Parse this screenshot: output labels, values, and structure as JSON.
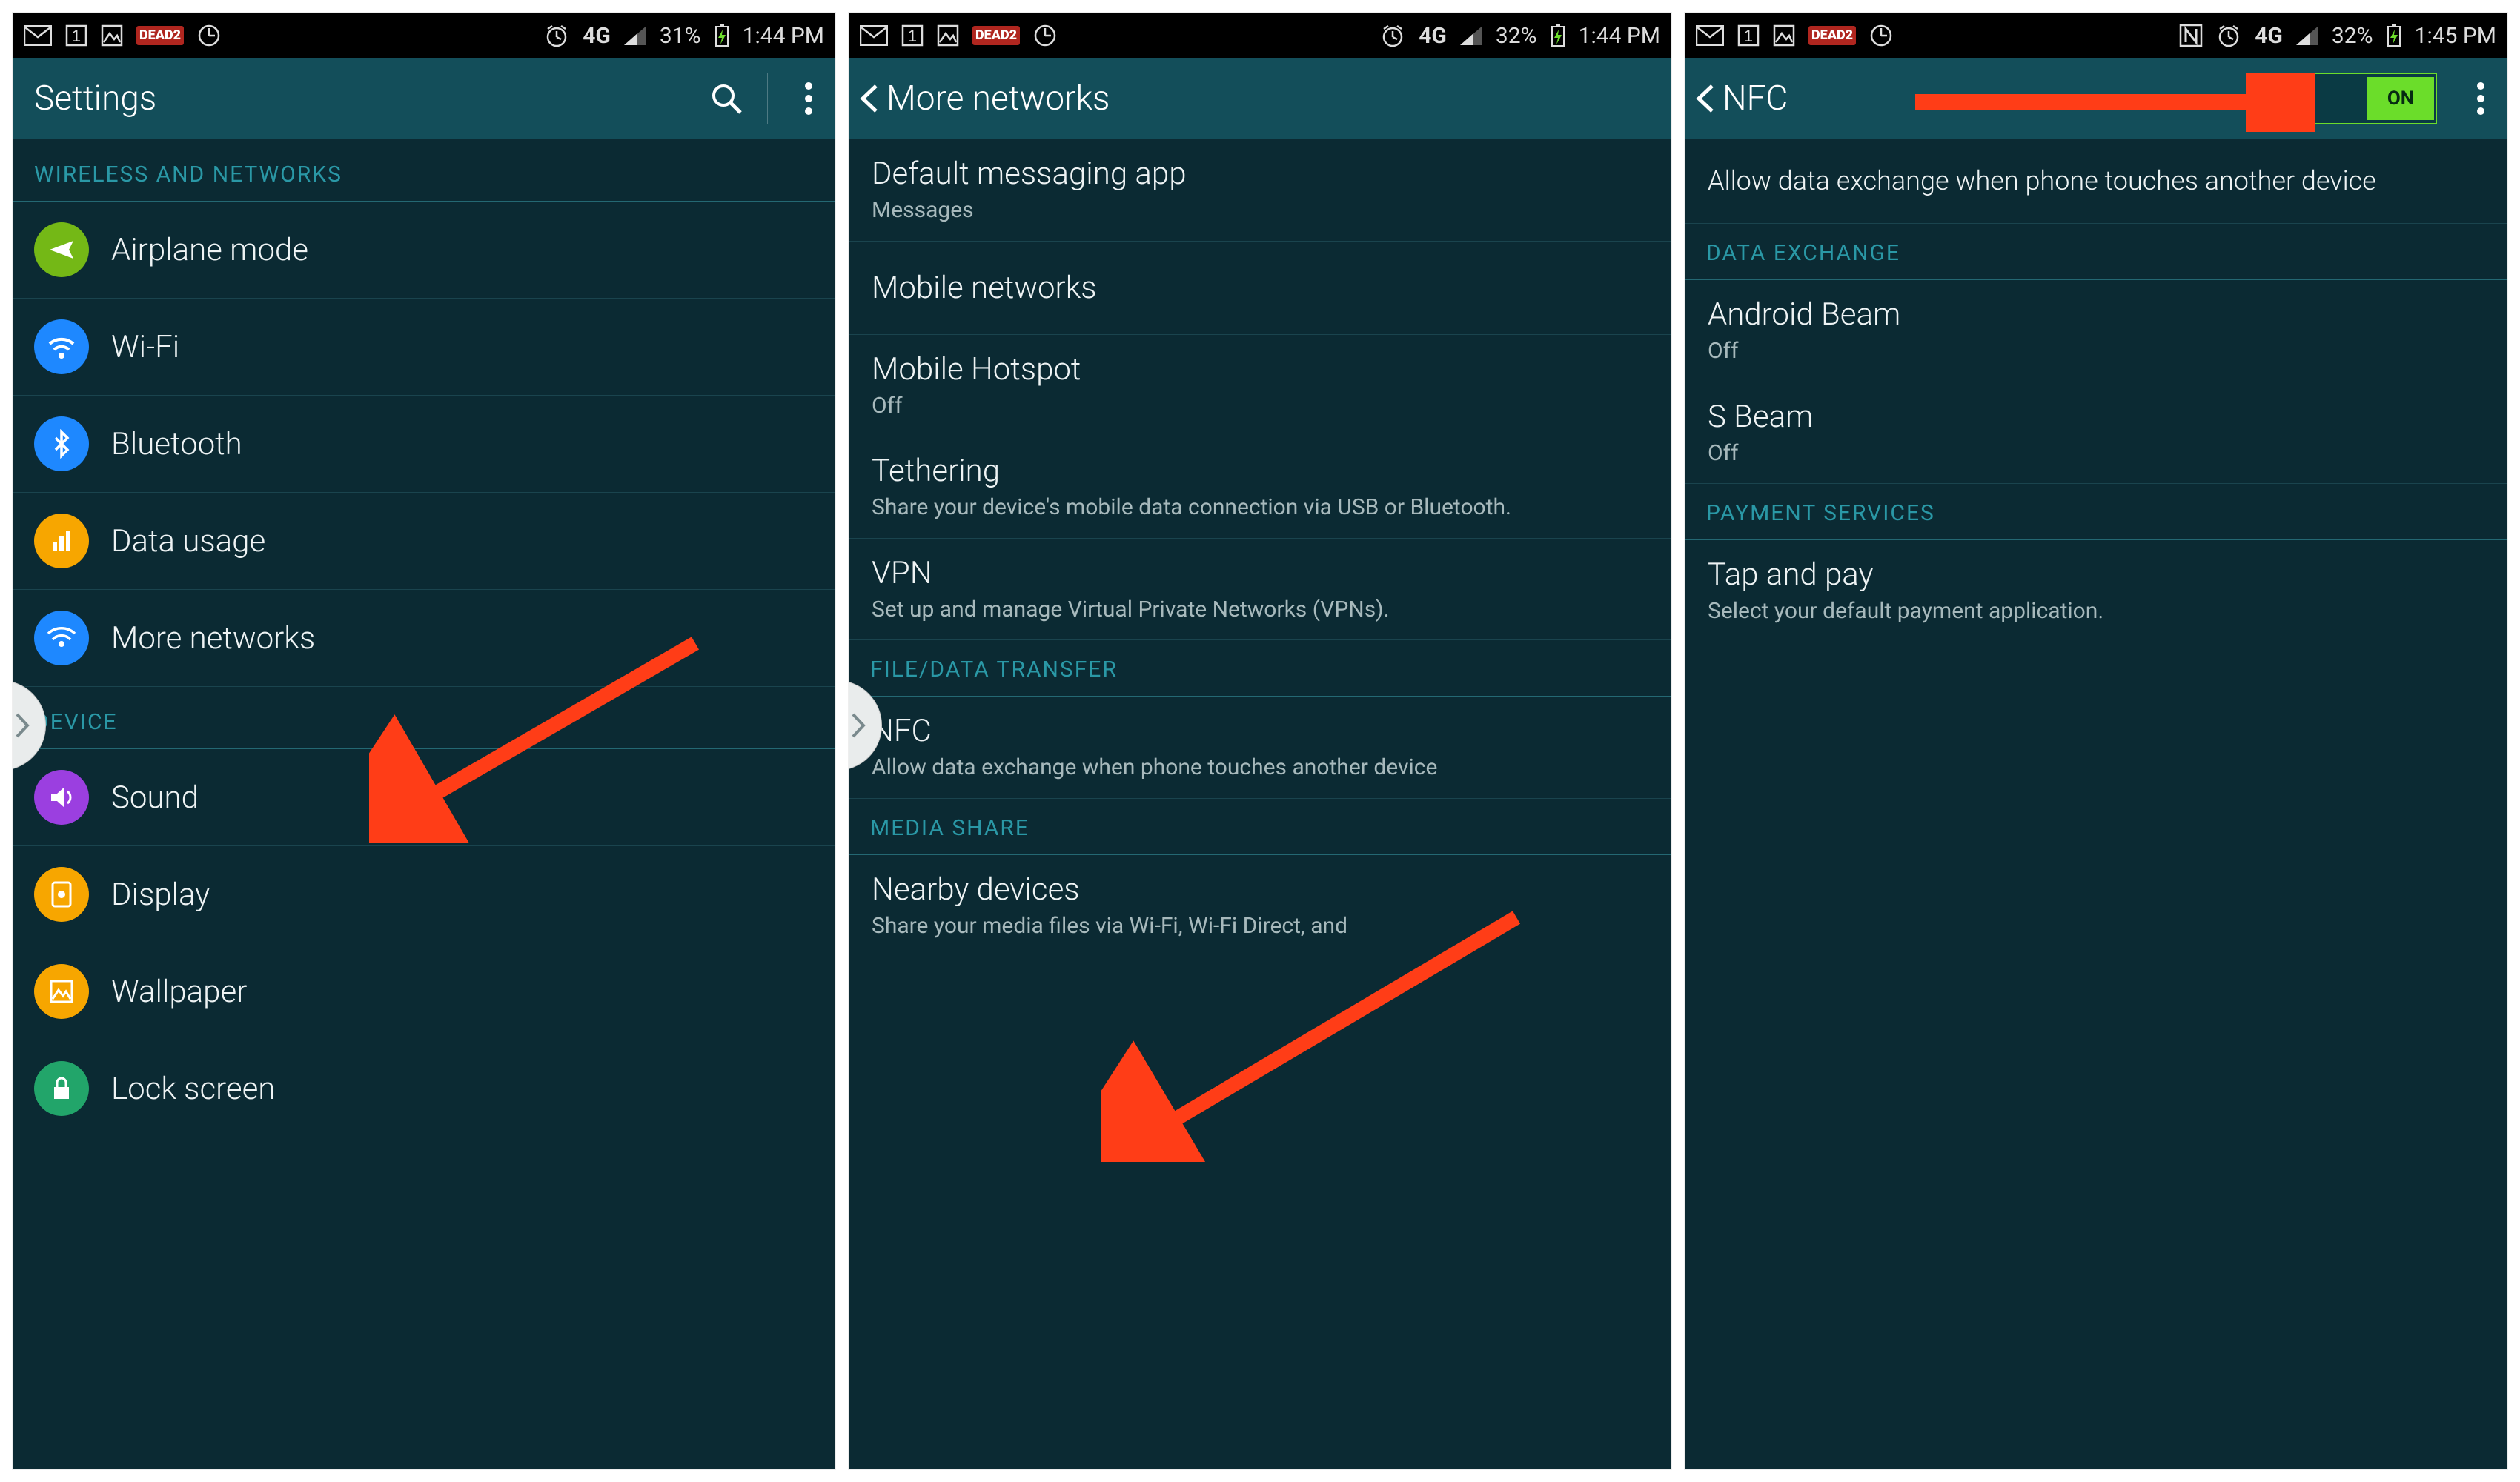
{
  "s1": {
    "status": {
      "battery": "31%",
      "time": "1:44 PM"
    },
    "title": "Settings",
    "sectA": "WIRELESS AND NETWORKS",
    "airplane": "Airplane mode",
    "wifi": "Wi-Fi",
    "bt": "Bluetooth",
    "data": "Data usage",
    "more": "More networks",
    "sectB": "DEVICE",
    "sound": "Sound",
    "display": "Display",
    "wallpaper": "Wallpaper",
    "lock": "Lock screen"
  },
  "s2": {
    "status": {
      "battery": "32%",
      "time": "1:44 PM"
    },
    "title": "More networks",
    "defmsg_t": "Default messaging app",
    "defmsg_s": "Messages",
    "mobnet": "Mobile networks",
    "hotspot_t": "Mobile Hotspot",
    "hotspot_s": "Off",
    "tether_t": "Tethering",
    "tether_s": "Share your device's mobile data connection via USB or Bluetooth.",
    "vpn_t": "VPN",
    "vpn_s": "Set up and manage Virtual Private Networks (VPNs).",
    "sectFile": "FILE/DATA TRANSFER",
    "nfc_t": "NFC",
    "nfc_s": "Allow data exchange when phone touches another device",
    "sectMedia": "MEDIA SHARE",
    "nearby_t": "Nearby devices",
    "nearby_s": "Share your media files via Wi-Fi, Wi-Fi Direct, and"
  },
  "s3": {
    "status": {
      "battery": "32%",
      "time": "1:45 PM"
    },
    "title": "NFC",
    "toggle": "ON",
    "desc": "Allow data exchange when phone touches another device",
    "sectData": "DATA EXCHANGE",
    "beam_t": "Android Beam",
    "beam_s": "Off",
    "sbeam_t": "S Beam",
    "sbeam_s": "Off",
    "sectPay": "PAYMENT SERVICES",
    "tap_t": "Tap and pay",
    "tap_s": "Select your default payment application."
  }
}
